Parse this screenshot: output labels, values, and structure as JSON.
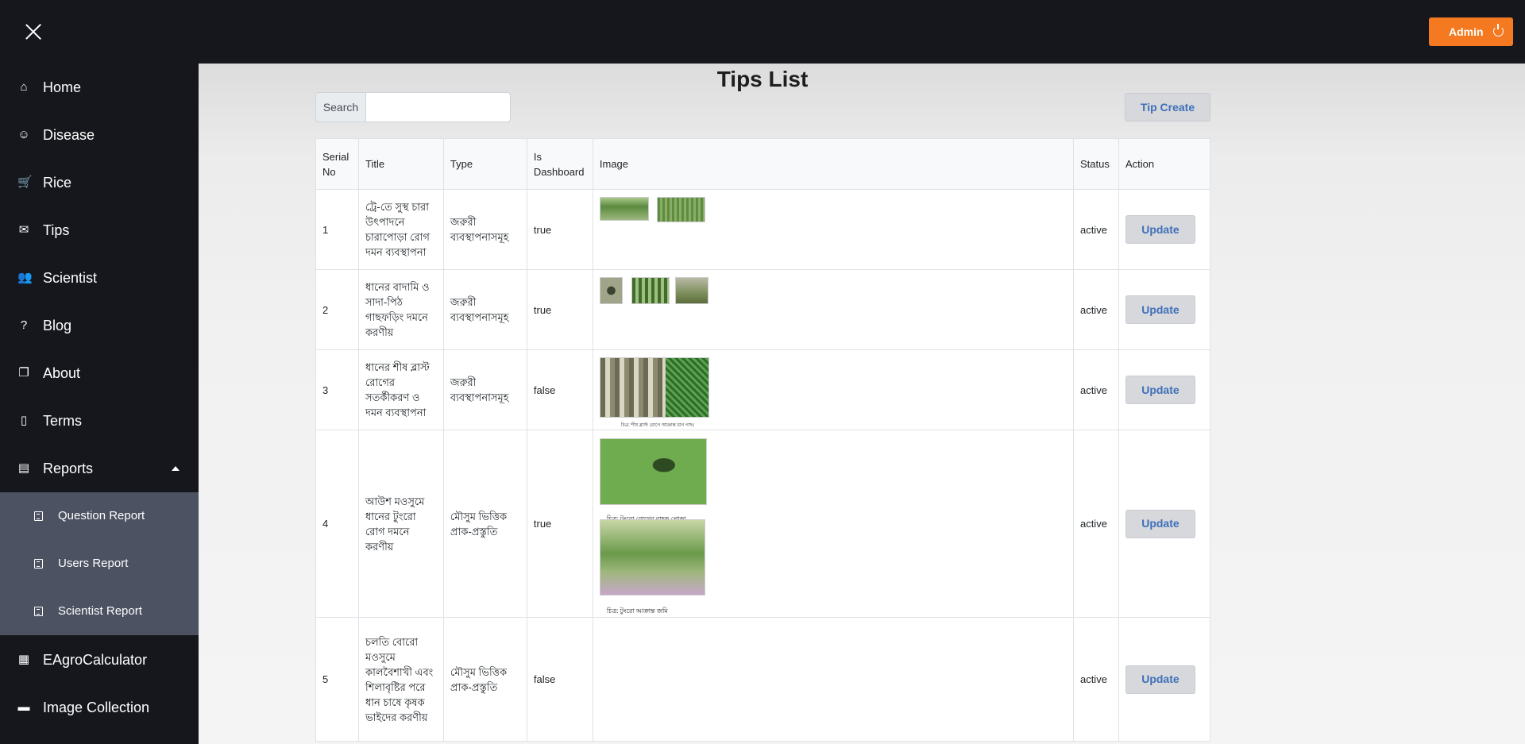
{
  "app": {
    "admin_label": "Admin"
  },
  "sidebar": {
    "items": [
      {
        "label": "Home",
        "icon": "home-icon",
        "glyph": "⌂"
      },
      {
        "label": "Disease",
        "icon": "smiley-icon",
        "glyph": "☺"
      },
      {
        "label": "Rice",
        "icon": "cart-icon",
        "glyph": "🛒"
      },
      {
        "label": "Tips",
        "icon": "inbox-icon",
        "glyph": "✉"
      },
      {
        "label": "Scientist",
        "icon": "users-icon",
        "glyph": "👥"
      },
      {
        "label": "Blog",
        "icon": "question-icon",
        "glyph": "?"
      },
      {
        "label": "About",
        "icon": "copy-icon",
        "glyph": "❐"
      },
      {
        "label": "Terms",
        "icon": "file-icon",
        "glyph": "▯"
      },
      {
        "label": "Reports",
        "icon": "report-icon",
        "glyph": "▤"
      }
    ],
    "reports_sub": [
      {
        "label": "Question Report"
      },
      {
        "label": "Users Report"
      },
      {
        "label": "Scientist Report"
      }
    ],
    "bottom_items": [
      {
        "label": "EAgroCalculator",
        "icon": "calculator-icon",
        "glyph": "▦"
      },
      {
        "label": "Image Collection",
        "icon": "folder-icon",
        "glyph": "▬"
      }
    ]
  },
  "page": {
    "title": "Tips List",
    "search_label": "Search",
    "search_placeholder": "",
    "create_label": "Tip Create"
  },
  "table": {
    "headers": [
      "Serial No",
      "Title",
      "Type",
      "Is Dashboard",
      "Image",
      "Status",
      "Action"
    ],
    "update_label": "Update",
    "rows": [
      {
        "serial": "1",
        "title": "ট্রে-তে সুস্থ চারা উৎপাদনে চারাপোড়া রোগ দমন ব্যবস্থাপনা",
        "type": "জরুরী ব্যবস্থাপনাসমূহ",
        "dashboard": "true",
        "status": "active"
      },
      {
        "serial": "2",
        "title": "ধানের বাদামি ও সাদা-পিঠ গাছফড়িং দমনে করণীয়",
        "type": "জরুরী ব্যবস্থাপনাসমূহ",
        "dashboard": "true",
        "status": "active"
      },
      {
        "serial": "3",
        "title": "ধানের শীষ ব্লাস্ট রোগের সতর্কীকরণ ও দমন ব্যবস্থাপনা",
        "type": "জরুরী ব্যবস্থাপনাসমূহ",
        "dashboard": "false",
        "status": "active",
        "caption": "চিত্র: শীষ ব্লাস্ট রোগে আক্রান্ত ধান গাছ।"
      },
      {
        "serial": "4",
        "title": "আউশ মওসুমে ধানের টুংরো রোগ দমনে করণীয়",
        "type": "মৌসুম ভিত্তিক প্রাক-প্রস্তুতি",
        "dashboard": "true",
        "status": "active",
        "caption1": "চিত্র: টুংরো রোগের বাহক পোকা",
        "caption2": "চিত্র: টুংরো আক্রান্ত জমি"
      },
      {
        "serial": "5",
        "title": "চলতি বোরো মওসুমে কালবৈশাখী এবং শিলাবৃষ্টির পরে ধান চাষে কৃষক ভাইদের করণীয়",
        "type": "মৌসুম ভিত্তিক প্রাক-প্রস্তুতি",
        "dashboard": "false",
        "status": "active"
      }
    ]
  }
}
